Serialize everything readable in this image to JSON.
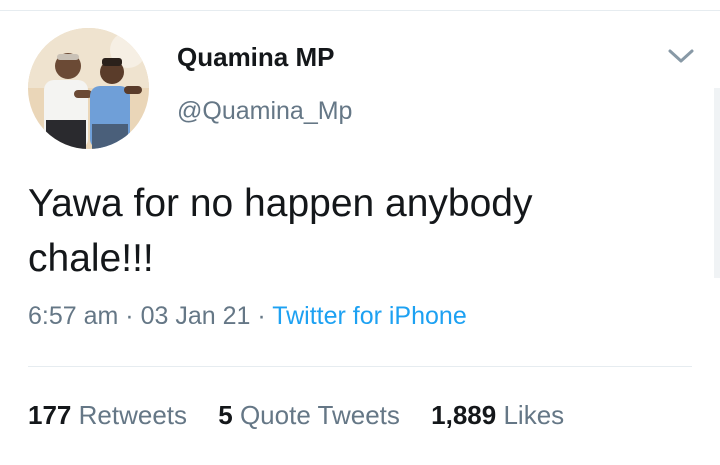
{
  "author": {
    "name": "Quamina MP",
    "handle": "@Quamina_Mp"
  },
  "tweet": {
    "text_line1": "Yawa for no happen anybody",
    "text_line2": "chale!!!",
    "time": "6:57 am",
    "separator": "·",
    "date": "03 Jan 21",
    "source": "Twitter for iPhone"
  },
  "stats": {
    "retweets_count": "177",
    "retweets_label": "Retweets",
    "quotes_count": "5",
    "quotes_label": "Quote Tweets",
    "likes_count": "1,889",
    "likes_label": "Likes"
  },
  "icons": {
    "menu": "chevron-down-icon"
  },
  "colors": {
    "text_primary": "#14171a",
    "text_secondary": "#657786",
    "link": "#1da1f2",
    "divider": "#e6ecf0"
  }
}
